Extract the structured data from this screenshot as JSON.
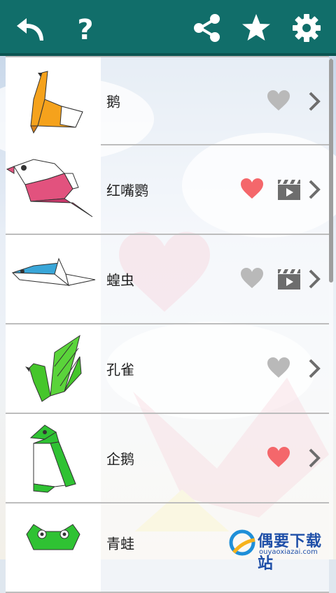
{
  "toolbar": {
    "back_icon": "back-arrow-icon",
    "help_icon": "question-mark-icon",
    "share_icon": "share-icon",
    "star_icon": "star-icon",
    "settings_icon": "gear-icon",
    "background_color": "#116e6a"
  },
  "list": {
    "items": [
      {
        "name": "鹅",
        "favorite": false,
        "has_video": false,
        "icon": "origami-swan"
      },
      {
        "name": "红嘴鹦",
        "favorite": true,
        "has_video": true,
        "icon": "origami-parrot"
      },
      {
        "name": "蝗虫",
        "favorite": false,
        "has_video": true,
        "icon": "origami-locust"
      },
      {
        "name": "孔雀",
        "favorite": false,
        "has_video": false,
        "icon": "origami-peacock"
      },
      {
        "name": "企鹅",
        "favorite": true,
        "has_video": false,
        "icon": "origami-penguin"
      },
      {
        "name": "青蛙",
        "favorite": false,
        "has_video": false,
        "icon": "origami-frog"
      }
    ]
  },
  "colors": {
    "heart_active": "#f4676b",
    "heart_inactive": "#b9b9b9",
    "icon_gray": "#6d6d6d"
  },
  "watermark": {
    "title": "偶要下载站",
    "url": "ouyaoxiazai.com"
  }
}
